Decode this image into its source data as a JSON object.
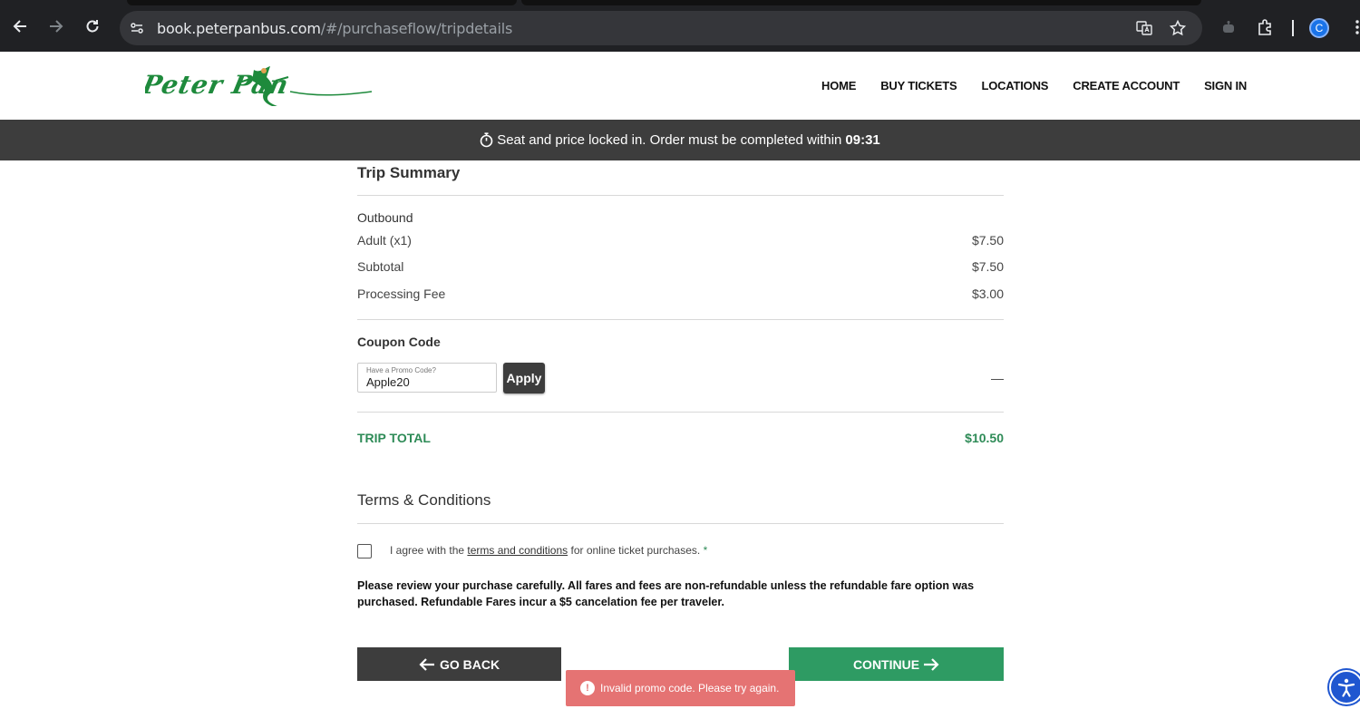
{
  "browser": {
    "url_host": "book.peterpanbus.com",
    "url_path": "/#/purchaseflow/tripdetails",
    "profile_initial": "C"
  },
  "header": {
    "logo_text": "Peter Pan",
    "nav": [
      "HOME",
      "BUY TICKETS",
      "LOCATIONS",
      "CREATE ACCOUNT",
      "SIGN IN"
    ]
  },
  "timer": {
    "message": "Seat and price locked in. Order must be completed within",
    "time": "09:31"
  },
  "summary": {
    "title": "Trip Summary",
    "direction": "Outbound",
    "lines": [
      {
        "label": "Adult (x1)",
        "value": "$7.50"
      },
      {
        "label": "Subtotal",
        "value": "$7.50"
      },
      {
        "label": "Processing Fee",
        "value": "$3.00"
      }
    ]
  },
  "coupon": {
    "title": "Coupon Code",
    "field_label": "Have a Promo Code?",
    "value": "Apple20",
    "apply_label": "Apply",
    "discount": "—"
  },
  "total": {
    "label": "TRIP TOTAL",
    "value": "$10.50"
  },
  "terms": {
    "title": "Terms & Conditions",
    "agree_prefix": "I agree with the",
    "link_text": "terms and conditions",
    "agree_suffix": "for online ticket purchases.",
    "required_mark": "*",
    "notice": "Please review your purchase carefully. All fares and fees are non-refundable unless the refundable fare option was purchased. Refundable Fares incur a $5 cancelation fee per traveler."
  },
  "actions": {
    "back_label": "GO BACK",
    "continue_label": "CONTINUE"
  },
  "toast": {
    "message": "Invalid promo code. Please try again."
  },
  "colors": {
    "brand_green": "#2e9b63",
    "dark_bar": "#3d3d3d",
    "error_toast": "#e57373"
  }
}
